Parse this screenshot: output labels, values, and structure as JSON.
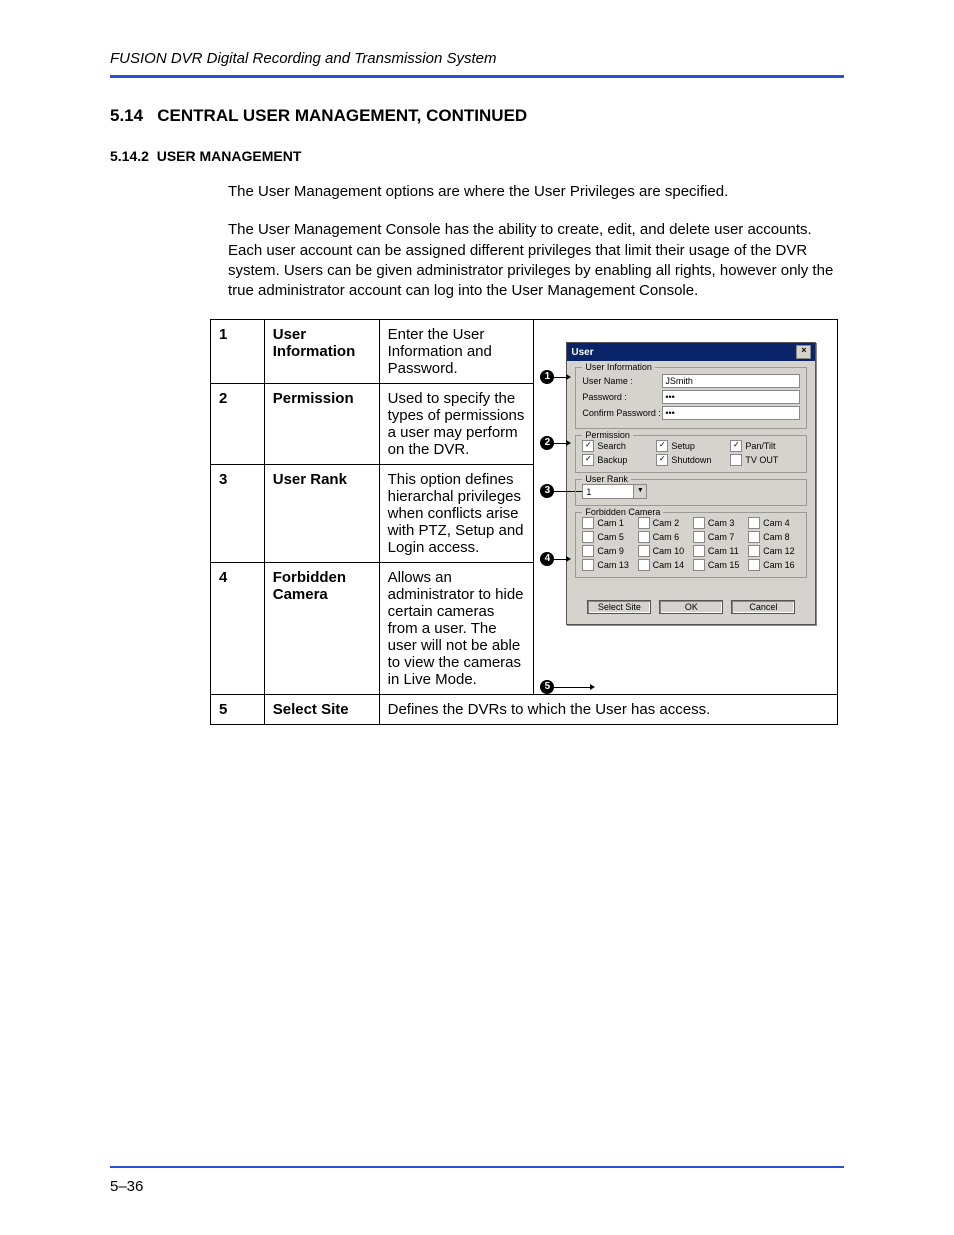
{
  "header": {
    "doc_title": "FUSION DVR Digital Recording and Transmission System"
  },
  "section": {
    "number": "5.14",
    "title": "CENTRAL USER MANAGEMENT, CONTINUED"
  },
  "subsection": {
    "number": "5.14.2",
    "title": "USER MANAGEMENT"
  },
  "paragraphs": {
    "p1": "The User Management options are where the User Privileges are specified.",
    "p2": "The User Management Console has the ability to create, edit, and delete user accounts. Each user account can be assigned different privileges that limit their usage of the DVR system. Users can be given administrator privileges by enabling all rights, however only the true administrator account can log into the User Management Console."
  },
  "rows": [
    {
      "num": "1",
      "name": "User Information",
      "desc": "Enter the User Information and Password."
    },
    {
      "num": "2",
      "name": "Permission",
      "desc": "Used to specify the types of permissions a user may perform on the DVR."
    },
    {
      "num": "3",
      "name": "User Rank",
      "desc": "This option defines hierarchal privileges when conflicts arise with PTZ, Setup and Login access."
    },
    {
      "num": "4",
      "name": "Forbidden Camera",
      "desc": "Allows an administrator to hide certain cameras from a user. The user will not be able to view the cameras in Live Mode."
    },
    {
      "num": "5",
      "name": "Select Site",
      "desc": "Defines the DVRs to which the User has access."
    }
  ],
  "dialog": {
    "title": "User",
    "groups": {
      "user_info": {
        "label": "User Information",
        "username_lbl": "User Name :",
        "username_val": "JSmith",
        "password_lbl": "Password :",
        "password_val": "•••",
        "confirm_lbl": "Confirm Password :",
        "confirm_val": "•••"
      },
      "permission": {
        "label": "Permission",
        "items": [
          {
            "label": "Search",
            "checked": true
          },
          {
            "label": "Setup",
            "checked": true
          },
          {
            "label": "Pan/Tilt",
            "checked": true
          },
          {
            "label": "Backup",
            "checked": true
          },
          {
            "label": "Shutdown",
            "checked": true
          },
          {
            "label": "TV OUT",
            "checked": false
          }
        ]
      },
      "user_rank": {
        "label": "User Rank",
        "value": "1"
      },
      "forbidden": {
        "label": "Forbidden Camera",
        "cams": [
          "Cam 1",
          "Cam 2",
          "Cam 3",
          "Cam 4",
          "Cam 5",
          "Cam 6",
          "Cam 7",
          "Cam 8",
          "Cam 9",
          "Cam 10",
          "Cam 11",
          "Cam 12",
          "Cam 13",
          "Cam 14",
          "Cam 15",
          "Cam 16"
        ]
      }
    },
    "buttons": {
      "select_site": "Select Site",
      "ok": "OK",
      "cancel": "Cancel"
    }
  },
  "callouts": [
    "1",
    "2",
    "3",
    "4",
    "5"
  ],
  "footer": {
    "page": "5–36"
  }
}
